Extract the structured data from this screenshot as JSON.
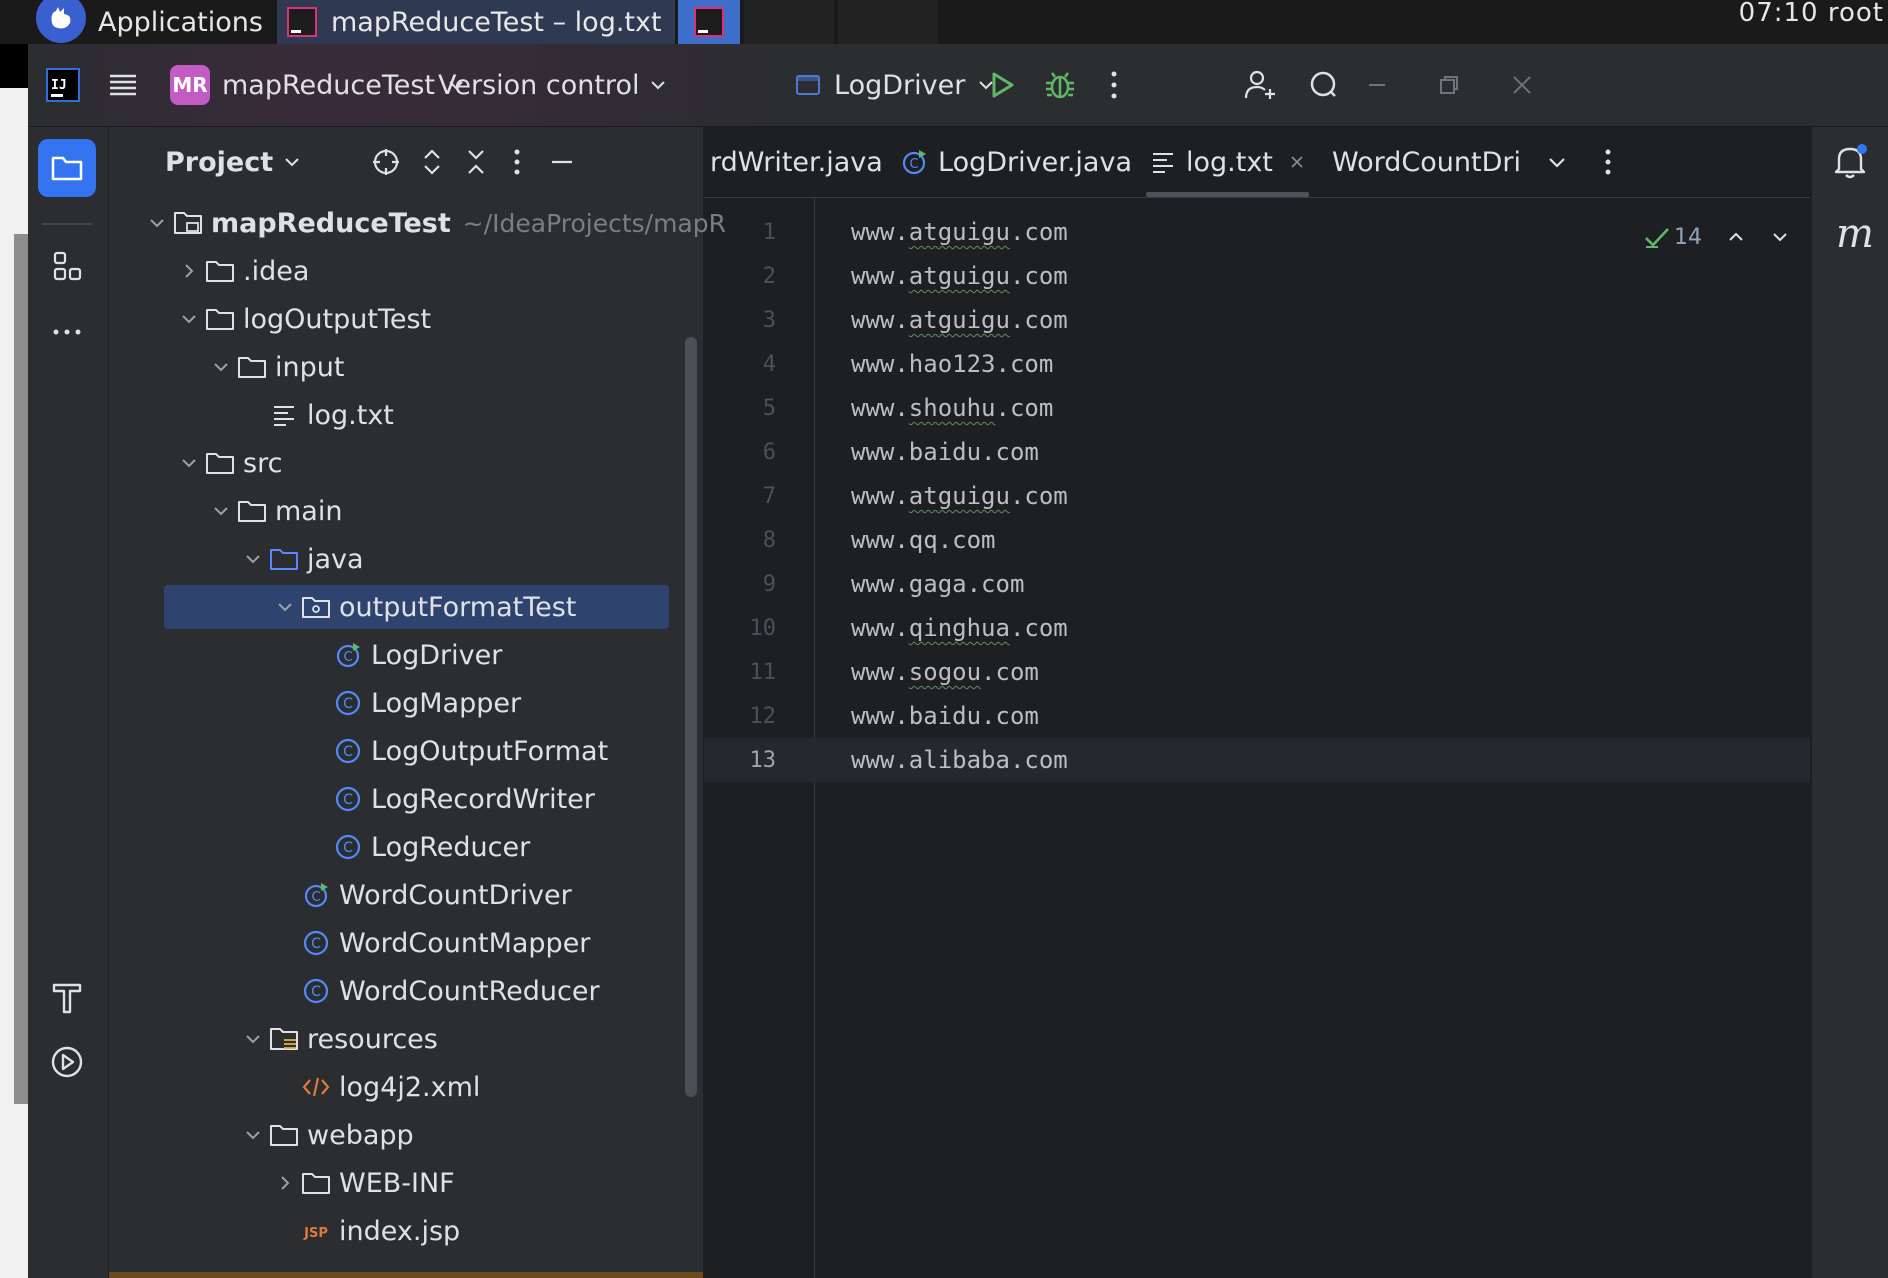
{
  "taskbar": {
    "applications_label": "Applications",
    "window_title": "mapReduceTest – log.txt",
    "clock": "07:10 root"
  },
  "titlebar": {
    "project_badge": "MR",
    "project_name": "mapReduceTest",
    "vcs_label": "Version control",
    "run_config": "LogDriver"
  },
  "project_panel": {
    "title": "Project",
    "tree": [
      {
        "label": "mapReduceTest",
        "hint": "~/IdeaProjects/mapR",
        "icon": "module-folder-icon",
        "depth": 0,
        "expanded": true
      },
      {
        "label": ".idea",
        "icon": "folder-icon",
        "depth": 1,
        "expanded": false
      },
      {
        "label": "logOutputTest",
        "icon": "folder-icon",
        "depth": 1,
        "expanded": true
      },
      {
        "label": "input",
        "icon": "folder-icon",
        "depth": 2,
        "expanded": true
      },
      {
        "label": "log.txt",
        "icon": "text-file-icon",
        "depth": 3
      },
      {
        "label": "src",
        "icon": "folder-icon",
        "depth": 1,
        "expanded": true
      },
      {
        "label": "main",
        "icon": "folder-icon",
        "depth": 2,
        "expanded": true
      },
      {
        "label": "java",
        "icon": "source-folder-icon",
        "depth": 3,
        "expanded": true
      },
      {
        "label": "outputFormatTest",
        "icon": "package-icon",
        "depth": 4,
        "expanded": true,
        "selected": true
      },
      {
        "label": "LogDriver",
        "icon": "runnable-class-icon",
        "depth": 5
      },
      {
        "label": "LogMapper",
        "icon": "class-icon",
        "depth": 5
      },
      {
        "label": "LogOutputFormat",
        "icon": "class-icon",
        "depth": 5
      },
      {
        "label": "LogRecordWriter",
        "icon": "class-icon",
        "depth": 5
      },
      {
        "label": "LogReducer",
        "icon": "class-icon",
        "depth": 5
      },
      {
        "label": "WordCountDriver",
        "icon": "runnable-class-icon",
        "depth": 4
      },
      {
        "label": "WordCountMapper",
        "icon": "class-icon",
        "depth": 4
      },
      {
        "label": "WordCountReducer",
        "icon": "class-icon",
        "depth": 4
      },
      {
        "label": "resources",
        "icon": "resources-folder-icon",
        "depth": 3,
        "expanded": true
      },
      {
        "label": "log4j2.xml",
        "icon": "xml-file-icon",
        "depth": 4
      },
      {
        "label": "webapp",
        "icon": "folder-icon",
        "depth": 3,
        "expanded": true
      },
      {
        "label": "WEB-INF",
        "icon": "folder-icon",
        "depth": 4,
        "expanded": false
      },
      {
        "label": "index.jsp",
        "icon": "jsp-file-icon",
        "depth": 4
      }
    ]
  },
  "tabs": [
    {
      "label": "rdWriter.java",
      "icon": "none"
    },
    {
      "label": "LogDriver.java",
      "icon": "runnable-class-icon"
    },
    {
      "label": "log.txt",
      "icon": "text-file-icon",
      "active": true,
      "closable": true
    },
    {
      "label": "WordCountDriv",
      "icon": "runnable-class-icon"
    }
  ],
  "editor": {
    "inspection_count": "14",
    "lines": [
      {
        "n": "1",
        "text": "www.atguigu.com"
      },
      {
        "n": "2",
        "text": "www.atguigu.com"
      },
      {
        "n": "3",
        "text": "www.atguigu.com"
      },
      {
        "n": "4",
        "text": "www.hao123.com"
      },
      {
        "n": "5",
        "text": "www.shouhu.com"
      },
      {
        "n": "6",
        "text": "www.baidu.com"
      },
      {
        "n": "7",
        "text": "www.atguigu.com"
      },
      {
        "n": "8",
        "text": "www.qq.com"
      },
      {
        "n": "9",
        "text": "www.gaga.com"
      },
      {
        "n": "10",
        "text": "www.qinghua.com"
      },
      {
        "n": "11",
        "text": "www.sogou.com"
      },
      {
        "n": "12",
        "text": "www.baidu.com"
      },
      {
        "n": "13",
        "text": "www.alibaba.com",
        "current": true
      }
    ]
  },
  "right_strip": {
    "maven_glyph": "m"
  },
  "colors": {
    "ide_bg": "#1e1f22",
    "panel_bg": "#2b2d30",
    "accent_blue": "#3574f0",
    "selection": "#2e436e",
    "run_green": "#5fb865",
    "class_icon": "#548af7"
  }
}
